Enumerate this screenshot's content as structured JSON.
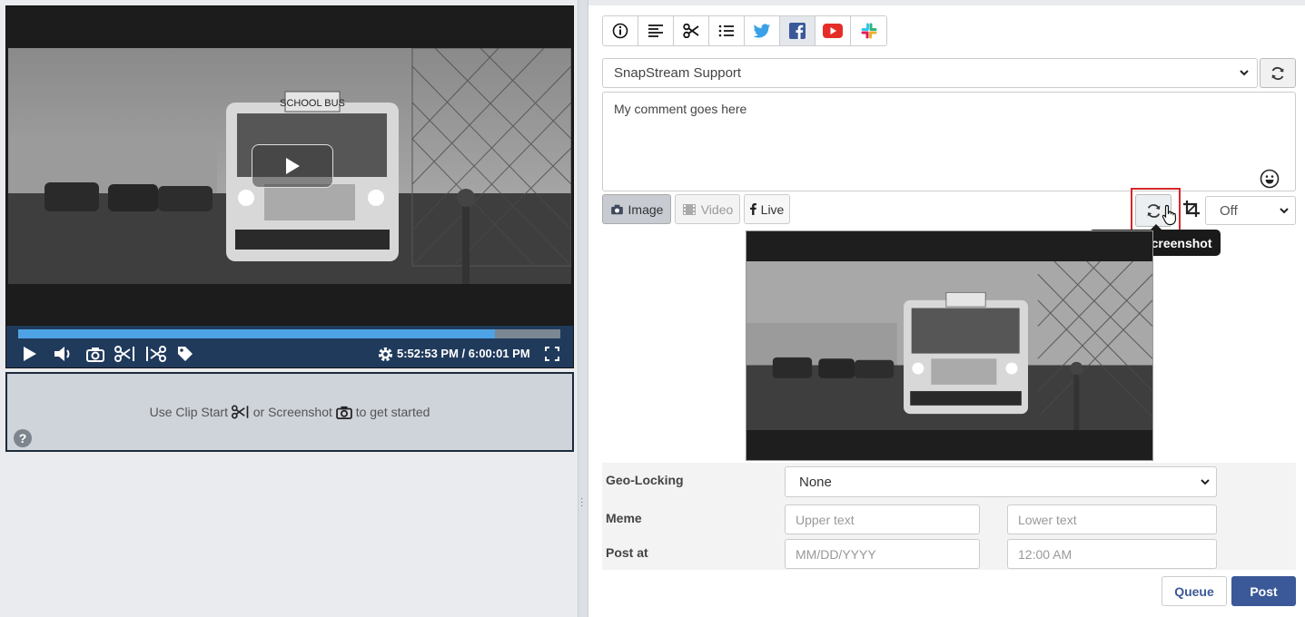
{
  "player": {
    "progress_fraction": 0.88,
    "current_time": "5:52:53 PM",
    "separator": " / ",
    "end_time": "6:00:01 PM",
    "video_text": "SCHOOL BUS"
  },
  "clip_area": {
    "msg_part1": "Use Clip Start",
    "msg_part2": "or Screenshot",
    "msg_part3": "to get started",
    "help_label": "?"
  },
  "tabs": [
    {
      "icon": "info-icon"
    },
    {
      "icon": "text-align-icon"
    },
    {
      "icon": "scissors-icon"
    },
    {
      "icon": "list-icon"
    },
    {
      "icon": "twitter-icon"
    },
    {
      "icon": "facebook-icon",
      "active": true
    },
    {
      "icon": "youtube-icon"
    },
    {
      "icon": "slack-icon"
    }
  ],
  "account": {
    "selected": "SnapStream Support"
  },
  "comment": {
    "value": "My comment goes here"
  },
  "media": {
    "image_label": "Image",
    "video_label": "Video",
    "live_label": "Live"
  },
  "crop": {
    "selected": "Off"
  },
  "tooltip": {
    "text": "Retake Screenshot"
  },
  "options": {
    "geo_label": "Geo-Locking",
    "geo_selected": "None",
    "meme_label": "Meme",
    "upper_placeholder": "Upper text",
    "lower_placeholder": "Lower text",
    "post_at_label": "Post at",
    "date_placeholder": "MM/DD/YYYY",
    "time_placeholder": "12:00 AM"
  },
  "actions": {
    "queue_label": "Queue",
    "post_label": "Post"
  },
  "colors": {
    "controls_bg": "#203a5c",
    "progress_fill": "#4ea3e6",
    "facebook_blue": "#3b5998",
    "highlight_red": "#d62828"
  }
}
